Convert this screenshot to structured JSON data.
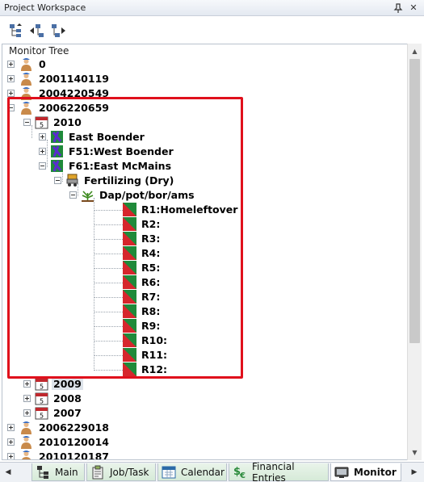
{
  "window": {
    "title": "Project Workspace",
    "pin_icon": "pin-icon",
    "close_glyph": "✕"
  },
  "toolbar": {
    "icons": [
      "tree-expand-icon",
      "tree-move-left-icon",
      "tree-move-right-icon"
    ]
  },
  "tree": {
    "header": "Monitor Tree",
    "nodes": [
      {
        "label": "0",
        "icon": "farmer-icon"
      },
      {
        "label": "2001140119",
        "icon": "farmer-icon"
      },
      {
        "label": "2004220549",
        "icon": "farmer-icon"
      },
      {
        "label": "2006220659",
        "icon": "farmer-icon"
      },
      {
        "label": "2010",
        "icon": "calendar-icon",
        "calendar_day": "5"
      },
      {
        "label": "East Boender",
        "icon": "field-icon"
      },
      {
        "label": "F51:West Boender",
        "icon": "field-icon"
      },
      {
        "label": "F61:East McMains",
        "icon": "field-icon"
      },
      {
        "label": "Fertilizing (Dry)",
        "icon": "fertilizer-spreader-icon"
      },
      {
        "label": "Dap/pot/bor/ams",
        "icon": "crop-sprout-icon"
      },
      {
        "label": "R1:Homeleftover",
        "icon": "record-icon"
      },
      {
        "label": "R2:",
        "icon": "record-icon"
      },
      {
        "label": "R3:",
        "icon": "record-icon"
      },
      {
        "label": "R4:",
        "icon": "record-icon"
      },
      {
        "label": "R5:",
        "icon": "record-icon"
      },
      {
        "label": "R6:",
        "icon": "record-icon"
      },
      {
        "label": "R7:",
        "icon": "record-icon"
      },
      {
        "label": "R8:",
        "icon": "record-icon"
      },
      {
        "label": "R9:",
        "icon": "record-icon"
      },
      {
        "label": "R10:",
        "icon": "record-icon"
      },
      {
        "label": "R11:",
        "icon": "record-icon"
      },
      {
        "label": "R12:",
        "icon": "record-icon"
      },
      {
        "label": "2009",
        "icon": "calendar-icon",
        "calendar_day": "5"
      },
      {
        "label": "2008",
        "icon": "calendar-icon",
        "calendar_day": "5"
      },
      {
        "label": "2007",
        "icon": "calendar-icon",
        "calendar_day": "5"
      },
      {
        "label": "2006229018",
        "icon": "farmer-icon"
      },
      {
        "label": "2010120014",
        "icon": "farmer-icon"
      },
      {
        "label": "2010120187",
        "icon": "farmer-icon"
      }
    ]
  },
  "tabs": [
    {
      "label": "Main",
      "icon": "hierarchy-icon"
    },
    {
      "label": "Job/Task",
      "icon": "clipboard-icon"
    },
    {
      "label": "Calendar",
      "icon": "calendar-tab-icon"
    },
    {
      "label": "Financial Entries",
      "icon": "dollar-euro-icon"
    },
    {
      "label": "Monitor",
      "icon": "monitor-icon"
    }
  ],
  "colors": {
    "highlight_box": "#e0101c",
    "tab_bg": "#d6ead8",
    "tree_border": "#b9c2cd"
  }
}
